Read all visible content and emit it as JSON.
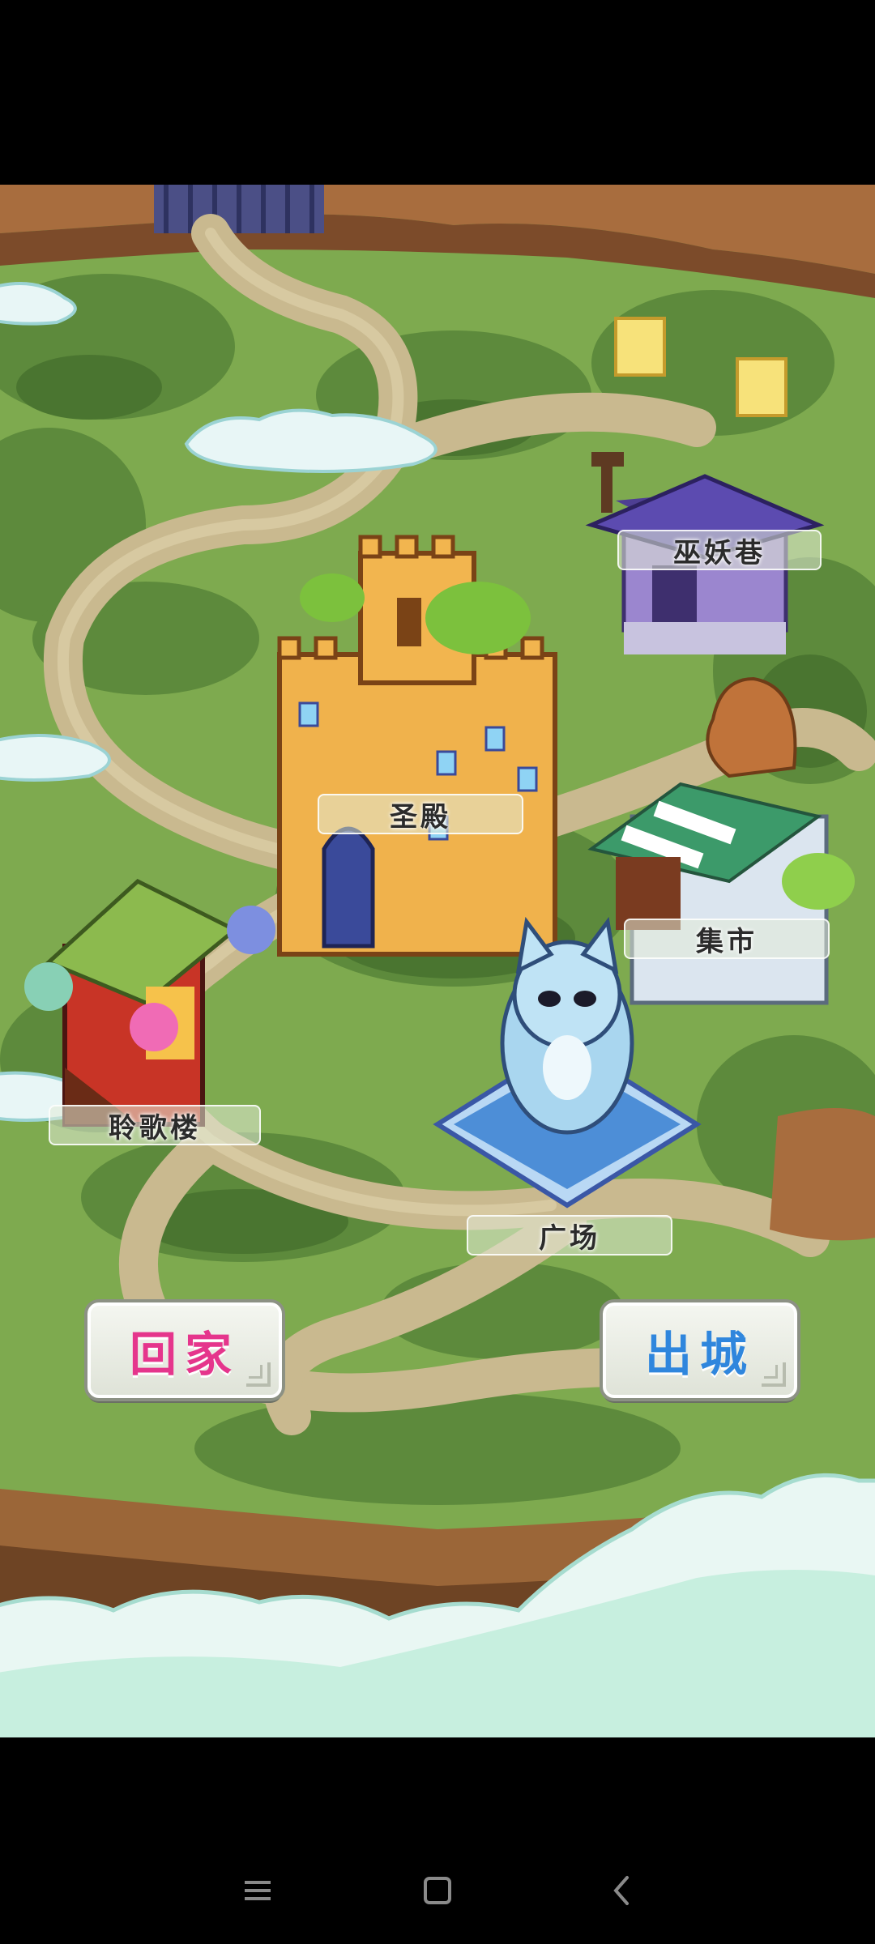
{
  "map": {
    "places": [
      {
        "id": "witch-alley",
        "label": "巫妖巷"
      },
      {
        "id": "temple",
        "label": "圣殿"
      },
      {
        "id": "market",
        "label": "集市"
      },
      {
        "id": "song-tower",
        "label": "聆歌楼"
      },
      {
        "id": "plaza",
        "label": "广场"
      }
    ]
  },
  "buttons": {
    "home_label": "回家",
    "leave_label": "出城"
  },
  "system_nav": {
    "menu_icon": "menu-icon",
    "home_icon": "square-home-icon",
    "back_icon": "back-chevron-icon"
  },
  "colors": {
    "home_text": "#e5358c",
    "leave_text": "#2f86dd",
    "grass": "#7eaa4f",
    "path": "#c9b98f"
  }
}
